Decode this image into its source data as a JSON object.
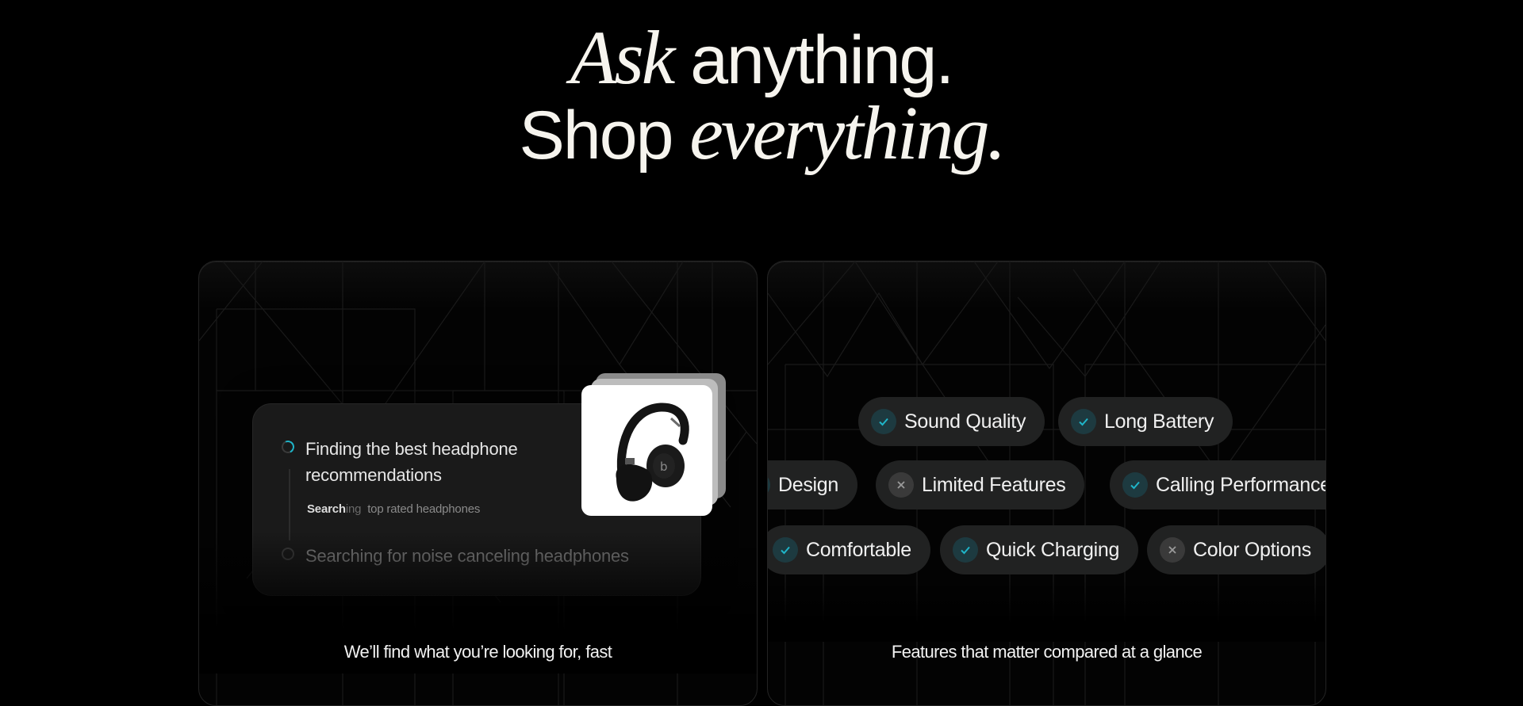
{
  "hero": {
    "line1_italic": "Ask",
    "line1_rest": " anything.",
    "line2_plain": "Shop ",
    "line2_italic": "everything."
  },
  "cards": [
    {
      "caption": "We’ll find what you’re looking for, fast",
      "steps": [
        {
          "label": "Finding the best headphone recommendations",
          "status": "in-progress",
          "icon": "spinner-icon"
        },
        {
          "label": "Searching for noise canceling headphones",
          "status": "pending",
          "icon": "empty-circle-icon"
        }
      ],
      "substep": {
        "highlight": "Search",
        "mid": "ing",
        "rest": "top rated headphones"
      },
      "product_image": "headphones-image"
    },
    {
      "caption": "Features that matter compared at a glance",
      "features": [
        {
          "label": "Sound Quality",
          "status": "check"
        },
        {
          "label": "Long Battery",
          "status": "check"
        },
        {
          "label": "Design",
          "status": "check"
        },
        {
          "label": "Limited Features",
          "status": "cross"
        },
        {
          "label": "Calling Performance",
          "status": "check"
        },
        {
          "label": "Comfortable",
          "status": "check"
        },
        {
          "label": "Quick Charging",
          "status": "check"
        },
        {
          "label": "Color Options",
          "status": "cross"
        }
      ]
    }
  ],
  "colors": {
    "background": "#000000",
    "accent": "#1fb5c9",
    "pill": "#212222",
    "panel": "#1a1a1a"
  }
}
